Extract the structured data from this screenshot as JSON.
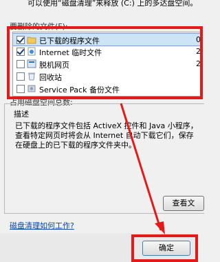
{
  "intro_text": "可以使用“磁盘清理”来释放 (C:) 上的多达盘空间。",
  "list_title": "要删除的文件(F):",
  "items": [
    {
      "label": "已下载的程序文件",
      "checked": true,
      "selected": true,
      "size": "0",
      "icon": "folder-icon"
    },
    {
      "label": "Internet 临时文件",
      "checked": true,
      "selected": false,
      "size": "2",
      "icon": "internet-icon"
    },
    {
      "label": "脱机网页",
      "checked": false,
      "selected": false,
      "size": "2",
      "icon": "offline-page-icon"
    },
    {
      "label": "回收站",
      "checked": false,
      "selected": false,
      "size": "",
      "icon": "recycle-bin-icon"
    },
    {
      "label": "Service Pack 备份文件",
      "checked": false,
      "selected": false,
      "size": "",
      "icon": "backup-icon"
    }
  ],
  "space_label": "占用磁盘空间总数:",
  "description_title": "描述",
  "description_text": "已下载的程序文件包括 ActiveX 控件和 Java 小程序，查看特定网页时将会从 Internet 自动下载它们，保存在硬盘上的已下载的程序文件夹中。",
  "view_button": "查看文",
  "help_link": "磁盘清理如何工作?",
  "ok_button": "确定",
  "colors": {
    "annotation_red": "#e31a1a",
    "selection": "#cde4f7"
  }
}
